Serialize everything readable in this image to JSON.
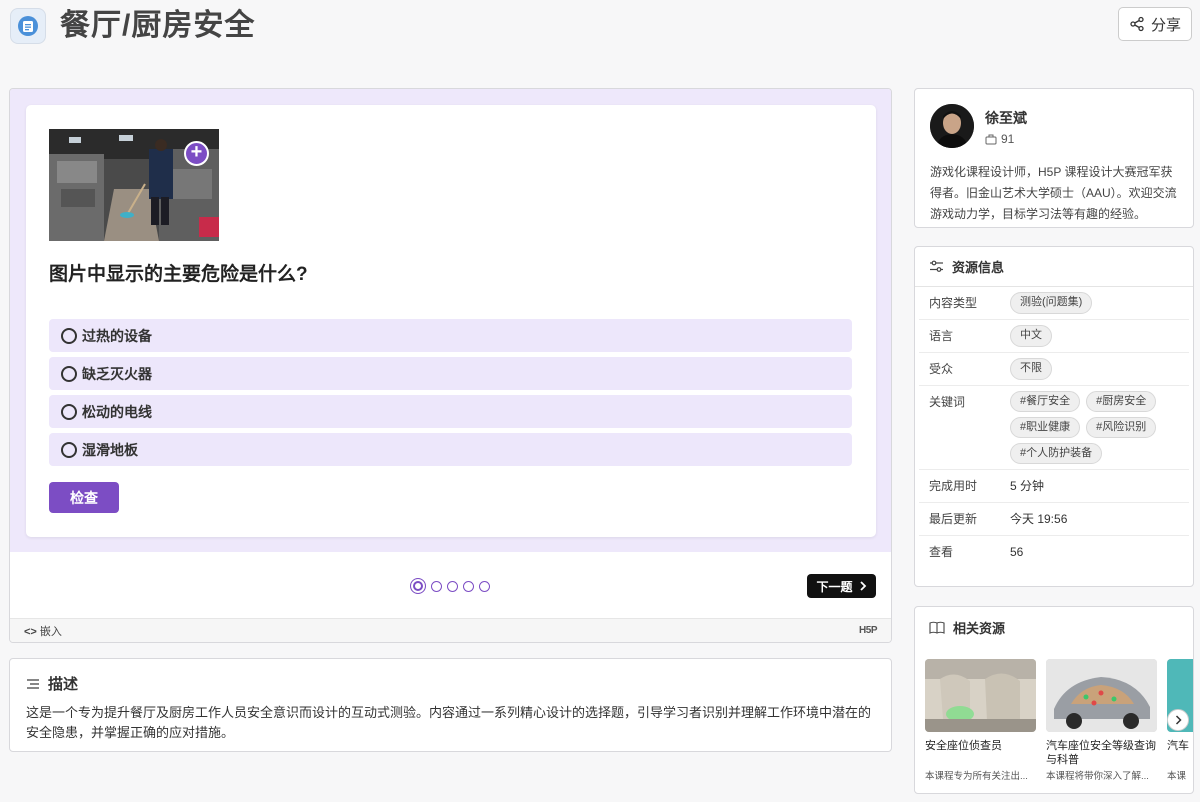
{
  "header": {
    "title": "餐厅/厨房安全",
    "share_label": "分享",
    "app_icon": "document-icon",
    "share_icon": "share-icon"
  },
  "player": {
    "question": "图片中显示的主要危险是什么?",
    "options": [
      "过热的设备",
      "缺乏灭火器",
      "松动的电线",
      "湿滑地板"
    ],
    "check_label": "检查",
    "next_label": "下一题",
    "slides_total": 5,
    "slide_current": 1,
    "embed_label": "嵌入",
    "brand": "H5P",
    "accent": "#7c4dc4"
  },
  "description": {
    "heading": "描述",
    "text": "这是一个专为提升餐厅及厨房工作人员安全意识而设计的互动式测验。内容通过一系列精心设计的选择题，引导学习者识别并理解工作环境中潜在的安全隐患，并掌握正确的应对措施。"
  },
  "author": {
    "name": "徐至斌",
    "count": "91",
    "bio": "游戏化课程设计师，H5P 课程设计大赛冠军获得者。旧金山艺术大学硕士（AAU）。欢迎交流游戏动力学，目标学习法等有趣的经验。"
  },
  "info": {
    "heading": "资源信息",
    "content_type_label": "内容类型",
    "content_type": "测验(问题集)",
    "language_label": "语言",
    "language": "中文",
    "audience_label": "受众",
    "audience": "不限",
    "keywords_label": "关键词",
    "keywords": [
      "#餐厅安全",
      "#厨房安全",
      "#职业健康",
      "#风险识别",
      "#个人防护装备"
    ],
    "duration_label": "完成用时",
    "duration": "5 分钟",
    "updated_label": "最后更新",
    "updated": "今天 19:56",
    "views_label": "查看",
    "views": "56"
  },
  "related": {
    "heading": "相关资源",
    "items": [
      {
        "title": "安全座位侦查员",
        "subtitle": "本课程专为所有关注出..."
      },
      {
        "title": "汽车座位安全等级查询与科普",
        "subtitle": "本课程将带你深入了解..."
      },
      {
        "title": "汽车",
        "subtitle": "本课"
      }
    ]
  }
}
